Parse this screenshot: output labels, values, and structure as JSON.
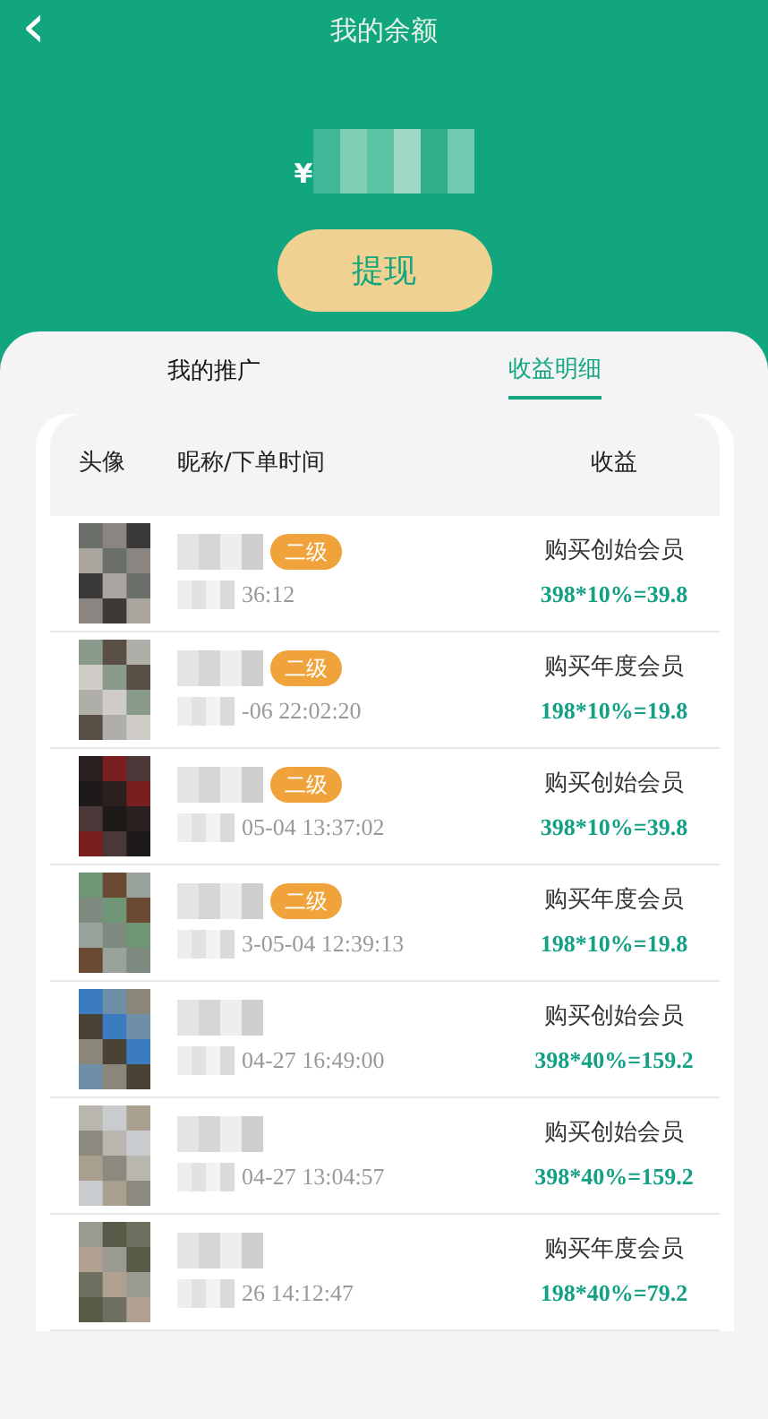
{
  "header": {
    "back_icon": "‹",
    "title": "我的余额"
  },
  "balance": {
    "currency": "¥"
  },
  "withdraw_button": "提现",
  "tabs": [
    {
      "label": "我的推广",
      "selected": false
    },
    {
      "label": "收益明细",
      "selected": true
    }
  ],
  "table": {
    "columns": [
      "头像",
      "昵称/下单时间",
      "收益"
    ],
    "rows": [
      {
        "level_badge": "二级",
        "time": "36:12",
        "item": "购买创始会员",
        "income": "398*10%=39.8"
      },
      {
        "level_badge": "二级",
        "time": "-06 22:02:20",
        "item": "购买年度会员",
        "income": "198*10%=19.8"
      },
      {
        "level_badge": "二级",
        "time": "05-04 13:37:02",
        "item": "购买创始会员",
        "income": "398*10%=39.8"
      },
      {
        "level_badge": "二级",
        "time": "3-05-04 12:39:13",
        "item": "购买年度会员",
        "income": "198*10%=19.8"
      },
      {
        "time": "04-27 16:49:00",
        "item": "购买创始会员",
        "income": "398*40%=159.2"
      },
      {
        "time": "04-27 13:04:57",
        "item": "购买创始会员",
        "income": "398*40%=159.2"
      },
      {
        "time": "26 14:12:47",
        "item": "购买年度会员",
        "income": "198*40%=79.2"
      }
    ]
  }
}
